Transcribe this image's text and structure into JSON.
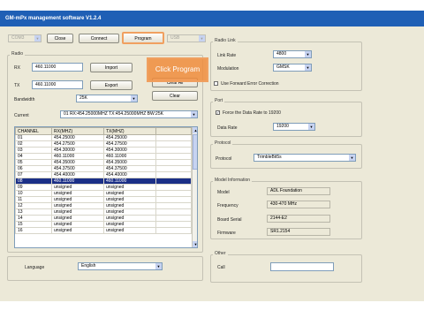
{
  "window": {
    "title": "GM-mPx management software V1.2.4"
  },
  "toolbar": {
    "port_value": "COM3",
    "close_label": "Close",
    "connect_label": "Connect",
    "program_label": "Program",
    "mode_value": "USB"
  },
  "radio": {
    "group_title": "Radio",
    "rx_label": "RX",
    "rx_value": "460.11000",
    "tx_label": "TX",
    "tx_value": "460.11000",
    "import_label": "Import",
    "export_label": "Export",
    "clear_all_label": "Clear All",
    "clear_label": "Clear",
    "bandwidth_label": "Bandwidth",
    "bandwidth_value": "25K",
    "current_label": "Current",
    "current_value": "01 RX:454.25000MHZ TX:454.25000MHZ BW:25K"
  },
  "channels": {
    "headers": [
      "CHANNEL",
      "RX(MHZ)",
      "TX(MHZ)"
    ],
    "rows": [
      [
        "01",
        "454.25000",
        "454.25000"
      ],
      [
        "02",
        "454.27500",
        "454.27500"
      ],
      [
        "03",
        "454.30000",
        "454.30000"
      ],
      [
        "04",
        "460.11000",
        "460.11000"
      ],
      [
        "05",
        "454.35000",
        "454.35000"
      ],
      [
        "06",
        "454.37500",
        "454.37500"
      ],
      [
        "07",
        "454.40000",
        "454.40000"
      ],
      [
        "08",
        "460.11000",
        "460.11000"
      ],
      [
        "09",
        "unsigned",
        "unsigned"
      ],
      [
        "10",
        "unsigned",
        "unsigned"
      ],
      [
        "11",
        "unsigned",
        "unsigned"
      ],
      [
        "12",
        "unsigned",
        "unsigned"
      ],
      [
        "13",
        "unsigned",
        "unsigned"
      ],
      [
        "14",
        "unsigned",
        "unsigned"
      ],
      [
        "15",
        "unsigned",
        "unsigned"
      ],
      [
        "16",
        "unsigned",
        "unsigned"
      ]
    ],
    "selected_index": 7
  },
  "language": {
    "label": "Language",
    "value": "English"
  },
  "radio_link": {
    "group_title": "Radio Link",
    "link_rate_label": "Link Rate",
    "link_rate_value": "4800",
    "modulation_label": "Modulation",
    "modulation_value": "GMSK",
    "fec_label": "Use Forward Error Correction",
    "fec_checked": false
  },
  "port": {
    "group_title": "Port",
    "force_label": "Force the Data Rate to 19200",
    "force_checked": true,
    "data_rate_label": "Data Rate",
    "data_rate_value": "19200"
  },
  "protocol": {
    "group_title": "Protocol",
    "label": "Protocol",
    "value": "TrimbleBit5s"
  },
  "model_info": {
    "group_title": "Model Information",
    "model_label": "Model",
    "model_value": "ADL Foundation",
    "frequency_label": "Frequency",
    "frequency_value": "430-470 MHz",
    "board_serial_label": "Board Serial",
    "board_serial_value": "2144-E2",
    "firmware_label": "Firmware",
    "firmware_value": "SR1.2154"
  },
  "other": {
    "group_title": "Other",
    "call_label": "Call",
    "call_value": ""
  },
  "tooltip": {
    "text": "Click Program"
  },
  "colors": {
    "titlebar": "#1f5fb5",
    "selection": "#1b2f87",
    "tooltip": "#f08c3c"
  }
}
